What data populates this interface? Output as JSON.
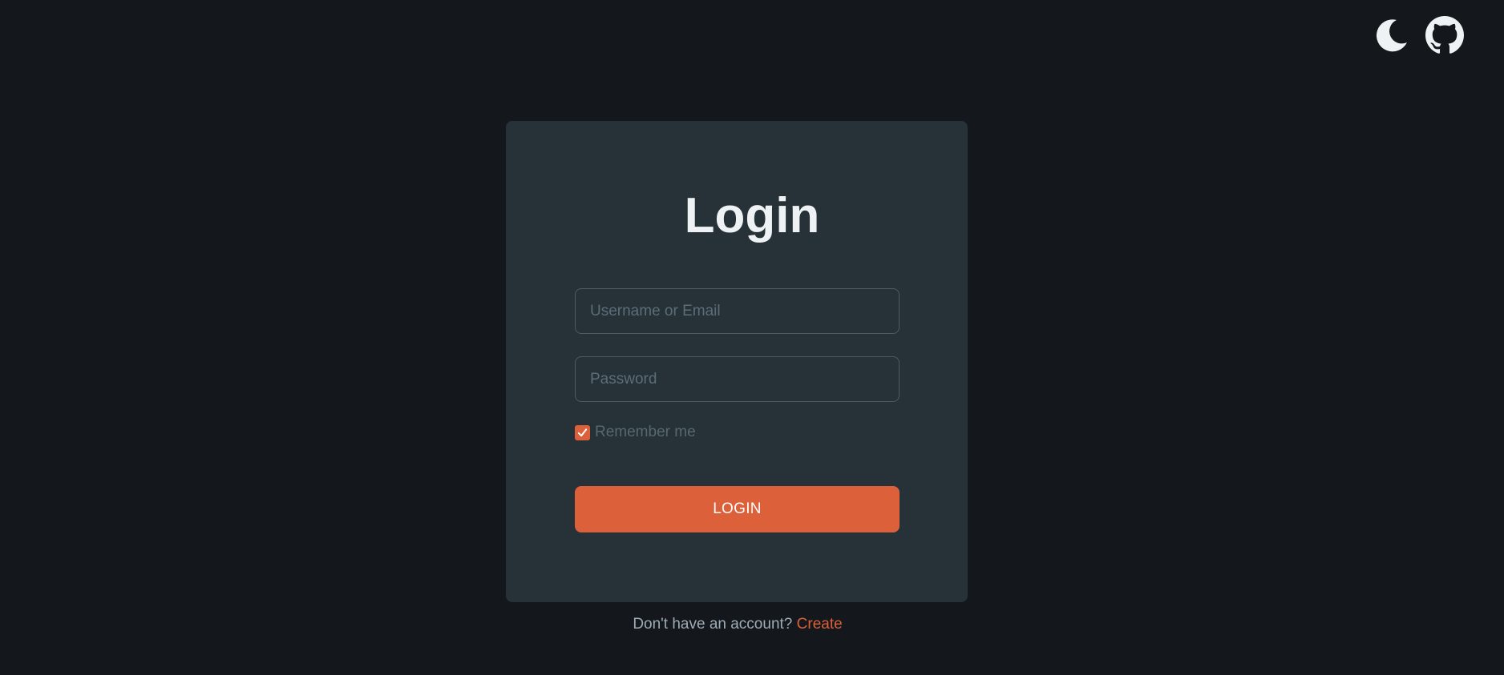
{
  "header": {
    "theme_toggle_icon": "moon-icon",
    "github_icon": "github-icon"
  },
  "login": {
    "title": "Login",
    "username": {
      "value": "",
      "placeholder": "Username or Email"
    },
    "password": {
      "value": "",
      "placeholder": "Password"
    },
    "remember": {
      "label": "Remember me",
      "checked": true
    },
    "submit_label": "LOGIN"
  },
  "footer": {
    "prompt": "Don't have an account?",
    "link_label": "Create"
  },
  "colors": {
    "background": "#14181c",
    "card": "#263238",
    "accent": "#dc603a",
    "title": "#eef2f4",
    "muted": "#59686f"
  }
}
